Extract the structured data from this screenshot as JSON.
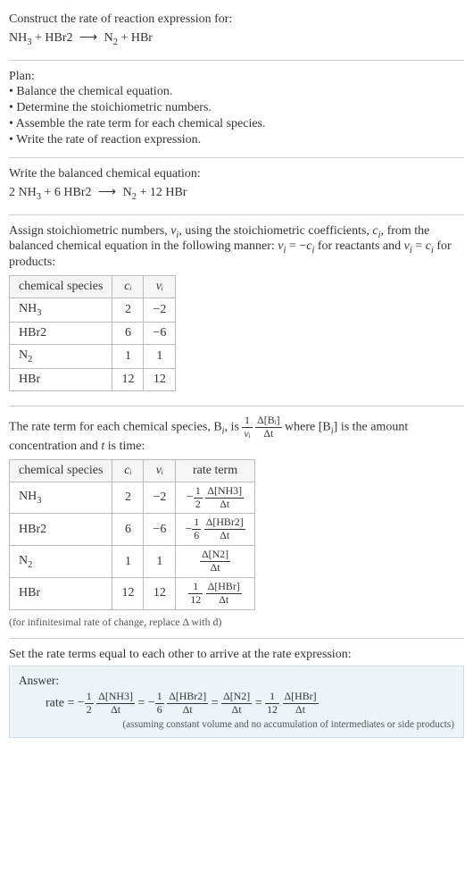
{
  "intro": {
    "title": "Construct the rate of reaction expression for:",
    "eq_lhs1": "NH",
    "eq_lhs1_sub": "3",
    "eq_plus1": " + HBr2  ",
    "eq_arrow": "⟶",
    "eq_rhs1": "  N",
    "eq_rhs1_sub": "2",
    "eq_rhs_rest": " + HBr"
  },
  "plan": {
    "title": "Plan:",
    "b1": "• Balance the chemical equation.",
    "b2": "• Determine the stoichiometric numbers.",
    "b3": "• Assemble the rate term for each chemical species.",
    "b4": "• Write the rate of reaction expression."
  },
  "balanced": {
    "title": "Write the balanced chemical equation:",
    "pre1": "2 NH",
    "sub1": "3",
    "mid1": " + 6 HBr2  ",
    "arrow": "⟶",
    "post1": "  N",
    "sub2": "2",
    "rest": " + 12 HBr"
  },
  "stoich_text": {
    "line1a": "Assign stoichiometric numbers, ",
    "vi": "ν",
    "isub": "i",
    "line1b": ", using the stoichiometric coefficients, ",
    "ci": "c",
    "line1c": ", from the balanced chemical equation in the following manner: ",
    "eq1a": " = −",
    "line1d": " for reactants and ",
    "eq2a": " = ",
    "line1e": " for products:"
  },
  "table1": {
    "h1": "chemical species",
    "h2": "cᵢ",
    "h3": "νᵢ",
    "r1c1a": "NH",
    "r1c1sub": "3",
    "r1c2": "2",
    "r1c3": "−2",
    "r2c1": "HBr2",
    "r2c2": "6",
    "r2c3": "−6",
    "r3c1a": "N",
    "r3c1sub": "2",
    "r3c2": "1",
    "r3c3": "1",
    "r4c1": "HBr",
    "r4c2": "12",
    "r4c3": "12"
  },
  "rate_text": {
    "a": "The rate term for each chemical species, B",
    "isub": "i",
    "b": ", is ",
    "f1num": "1",
    "f1den": "νᵢ",
    "f2num": "Δ[Bᵢ]",
    "f2den": "Δt",
    "c": " where [B",
    "d": "] is the amount concentration and ",
    "tvar": "t",
    "e": " is time:"
  },
  "table2": {
    "h1": "chemical species",
    "h2": "cᵢ",
    "h3": "νᵢ",
    "h4": "rate term",
    "r1": {
      "sp_a": "NH",
      "sp_sub": "3",
      "c": "2",
      "v": "−2",
      "sign": "−",
      "coef_num": "1",
      "coef_den": "2",
      "dnum": "Δ[NH3]",
      "dden": "Δt"
    },
    "r2": {
      "sp": "HBr2",
      "c": "6",
      "v": "−6",
      "sign": "−",
      "coef_num": "1",
      "coef_den": "6",
      "dnum": "Δ[HBr2]",
      "dden": "Δt"
    },
    "r3": {
      "sp_a": "N",
      "sp_sub": "2",
      "c": "1",
      "v": "1",
      "sign": "",
      "coef_num": "",
      "coef_den": "",
      "dnum": "Δ[N2]",
      "dden": "Δt"
    },
    "r4": {
      "sp": "HBr",
      "c": "12",
      "v": "12",
      "sign": "",
      "coef_num": "1",
      "coef_den": "12",
      "dnum": "Δ[HBr]",
      "dden": "Δt"
    }
  },
  "note1": "(for infinitesimal rate of change, replace Δ with d)",
  "final_intro": "Set the rate terms equal to each other to arrive at the rate expression:",
  "answer": {
    "title": "Answer:",
    "rate_label": "rate = ",
    "t1_sign": "−",
    "t1_cn": "1",
    "t1_cd": "2",
    "t1_dn": "Δ[NH3]",
    "t1_dd": "Δt",
    "eq": " = ",
    "t2_sign": "−",
    "t2_cn": "1",
    "t2_cd": "6",
    "t2_dn": "Δ[HBr2]",
    "t2_dd": "Δt",
    "t3_dn": "Δ[N2]",
    "t3_dd": "Δt",
    "t4_cn": "1",
    "t4_cd": "12",
    "t4_dn": "Δ[HBr]",
    "t4_dd": "Δt",
    "note": "(assuming constant volume and no accumulation of intermediates or side products)"
  }
}
